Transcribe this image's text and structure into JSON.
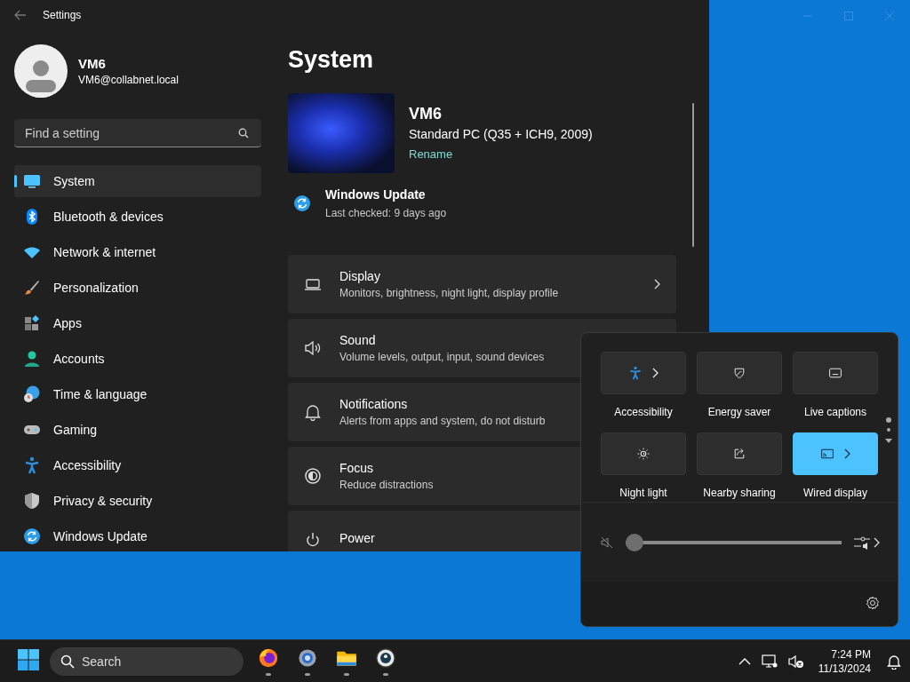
{
  "window": {
    "title": "Settings"
  },
  "user": {
    "name": "VM6",
    "email": "VM6@collabnet.local"
  },
  "search": {
    "placeholder": "Find a setting"
  },
  "nav": [
    {
      "label": "System",
      "selected": true
    },
    {
      "label": "Bluetooth & devices",
      "selected": false
    },
    {
      "label": "Network & internet",
      "selected": false
    },
    {
      "label": "Personalization",
      "selected": false
    },
    {
      "label": "Apps",
      "selected": false
    },
    {
      "label": "Accounts",
      "selected": false
    },
    {
      "label": "Time & language",
      "selected": false
    },
    {
      "label": "Gaming",
      "selected": false
    },
    {
      "label": "Accessibility",
      "selected": false
    },
    {
      "label": "Privacy & security",
      "selected": false
    },
    {
      "label": "Windows Update",
      "selected": false
    }
  ],
  "page": {
    "title": "System",
    "device": {
      "name": "VM6",
      "model": "Standard PC (Q35 + ICH9, 2009)",
      "rename": "Rename"
    },
    "update": {
      "title": "Windows Update",
      "status": "Last checked: 9 days ago"
    },
    "settings": [
      {
        "title": "Display",
        "subtitle": "Monitors, brightness, night light, display profile"
      },
      {
        "title": "Sound",
        "subtitle": "Volume levels, output, input, sound devices"
      },
      {
        "title": "Notifications",
        "subtitle": "Alerts from apps and system, do not disturb"
      },
      {
        "title": "Focus",
        "subtitle": "Reduce distractions"
      },
      {
        "title": "Power"
      }
    ]
  },
  "quick_settings": {
    "tiles": [
      {
        "label": "Accessibility",
        "on": false,
        "expandable": true
      },
      {
        "label": "Energy saver",
        "on": false,
        "expandable": false
      },
      {
        "label": "Live captions",
        "on": false,
        "expandable": false
      },
      {
        "label": "Night light",
        "on": false,
        "expandable": false
      },
      {
        "label": "Nearby sharing",
        "on": false,
        "expandable": false
      },
      {
        "label": "Wired display",
        "on": true,
        "expandable": true
      }
    ],
    "volume": {
      "level": 0
    }
  },
  "taskbar": {
    "search_placeholder": "Search",
    "apps": [
      {
        "running": true
      },
      {
        "running": true
      },
      {
        "running": true
      },
      {
        "running": true
      }
    ],
    "time": "7:24 PM",
    "date": "11/13/2024"
  }
}
